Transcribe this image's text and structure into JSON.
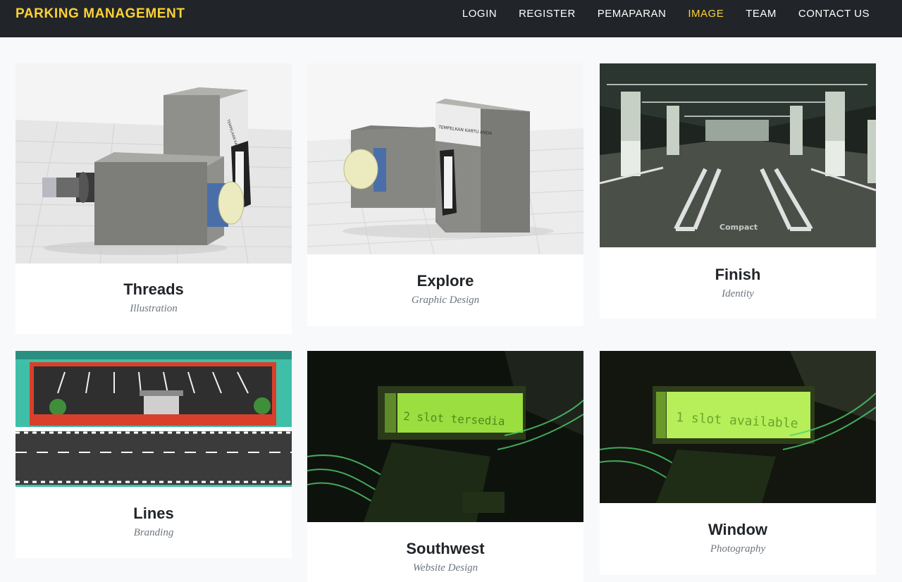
{
  "navbar": {
    "brand": "PARKING MANAGEMENT",
    "links": [
      "LOGIN",
      "REGISTER",
      "PEMAPARAN",
      "IMAGE",
      "TEAM",
      "CONTACT US"
    ],
    "active_link": "IMAGE",
    "background_color": "#212529",
    "accent_color": "#fed136"
  },
  "portfolio": {
    "items": [
      {
        "title": "Threads",
        "subtitle": "Illustration",
        "image": "3d-model-parking-device-with-button",
        "image_text": "TEMPELKAN KARTU ANDA"
      },
      {
        "title": "Explore",
        "subtitle": "Graphic Design",
        "image": "3d-model-parking-device-front-view",
        "image_text": "TEMPELKAN KARTU ANDA"
      },
      {
        "title": "Finish",
        "subtitle": "Identity",
        "image": "underground-parking-garage-photo",
        "image_text": "Compact"
      },
      {
        "title": "Lines",
        "subtitle": "Branding",
        "image": "miniature-parking-lot-model-photo",
        "image_text": ""
      },
      {
        "title": "Southwest",
        "subtitle": "Website Design",
        "image": "lcd-display-photo",
        "image_text": "2 slot tersedia"
      },
      {
        "title": "Window",
        "subtitle": "Photography",
        "image": "lcd-display-photo",
        "image_text": "1 slot available"
      }
    ]
  }
}
